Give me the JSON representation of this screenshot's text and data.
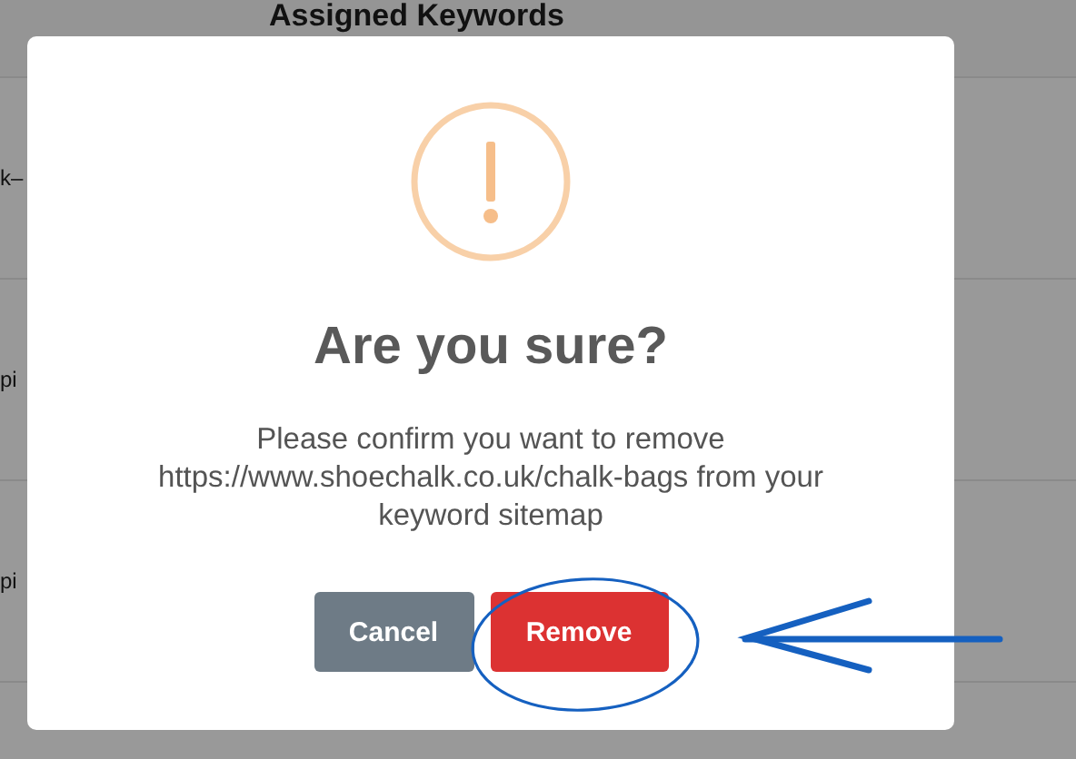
{
  "background": {
    "heading": "Assigned Keywords",
    "rows": [
      "k–",
      "pi",
      "pi"
    ]
  },
  "dialog": {
    "title": "Are you sure?",
    "message": "Please confirm you want to remove https://www.shoechalk.co.uk/chalk-bags from your keyword sitemap",
    "buttons": [
      {
        "label": "Cancel",
        "kind": "cancel"
      },
      {
        "label": "Remove",
        "kind": "confirm"
      }
    ]
  }
}
